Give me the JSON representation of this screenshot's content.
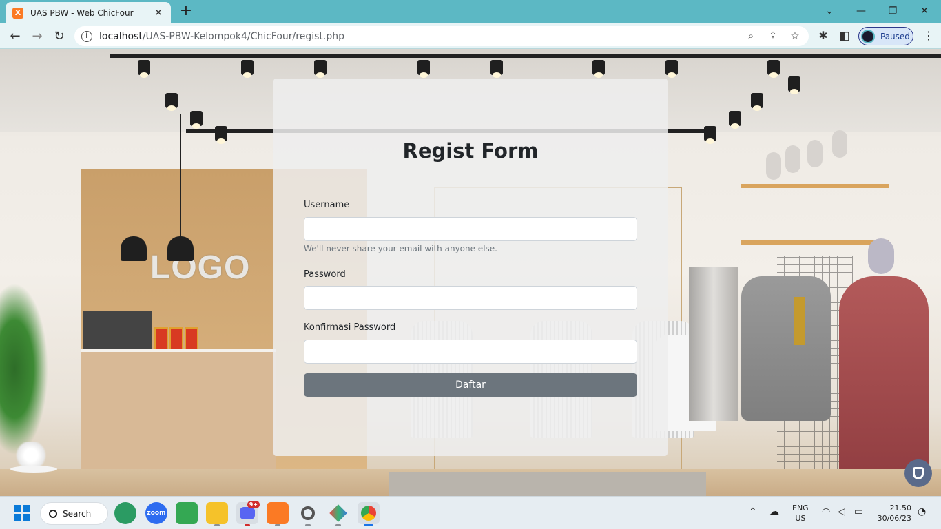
{
  "browser": {
    "tab_title": "UAS PBW - Web ChicFour",
    "favicon_letter": "X",
    "url_host": "localhost",
    "url_path": "/UAS-PBW-Kelompok4/ChicFour/regist.php",
    "profile_label": "Paused",
    "icons": {
      "back": "arrow-left-icon",
      "forward": "arrow-right-icon",
      "reload": "reload-icon",
      "site_info": "info-icon",
      "zoom": "zoom-icon",
      "share": "share-icon",
      "bookmark": "star-icon",
      "extensions": "puzzle-icon",
      "side_panel": "side-panel-icon",
      "menu": "more-vert-icon"
    }
  },
  "page": {
    "background_logo_text": "LOGO",
    "form": {
      "title": "Regist Form",
      "username_label": "Username",
      "username_value": "",
      "username_help": "We'll never share your email with anyone else.",
      "password_label": "Password",
      "password_value": "",
      "confirm_label": "Konfirmasi Password",
      "confirm_value": "",
      "submit_label": "Daftar"
    }
  },
  "taskbar": {
    "search_label": "Search",
    "discord_badge": "9+",
    "zoom_label": "zoom",
    "language_line1": "ENG",
    "language_line2": "US",
    "time": "21.50",
    "date": "30/06/23"
  },
  "colors": {
    "tabstrip": "#5cb8c4",
    "toolbar": "#e8f4f6",
    "submit_button": "#6c757d",
    "card": "#eeeeee"
  }
}
